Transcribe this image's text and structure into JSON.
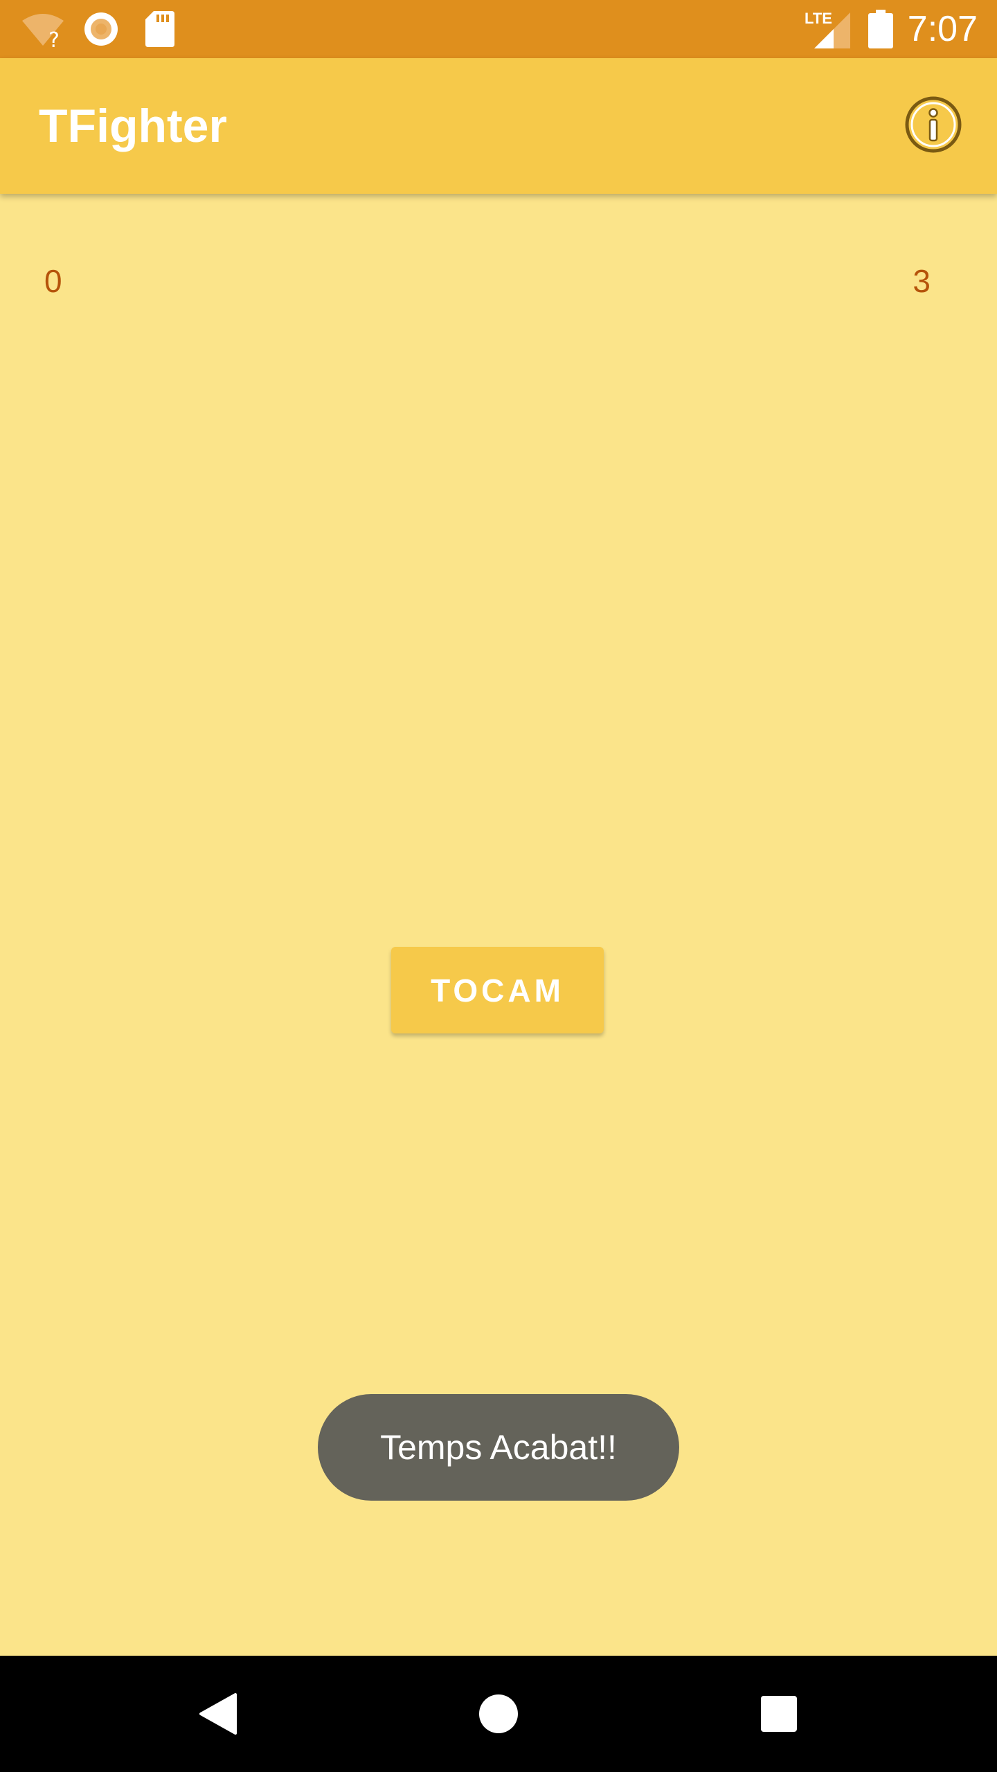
{
  "status_bar": {
    "time": "7:07",
    "network_label": "LTE",
    "icons": [
      "wifi-unknown-icon",
      "circle-status-icon",
      "sd-card-icon",
      "lte-signal-icon",
      "battery-icon"
    ],
    "background_color": "#DF8F1D"
  },
  "app_bar": {
    "title": "TFighter",
    "action_icon": "info-icon",
    "background_color": "#F6C94A"
  },
  "scores": {
    "left": "0",
    "right": "3",
    "color": "#B5530A"
  },
  "main": {
    "button_label": "TOCAM",
    "background_color": "#FBE48A"
  },
  "toast": {
    "message": "Temps Acabat!!"
  },
  "nav_bar": {
    "icons": [
      "back-icon",
      "home-icon",
      "recents-icon"
    ]
  }
}
